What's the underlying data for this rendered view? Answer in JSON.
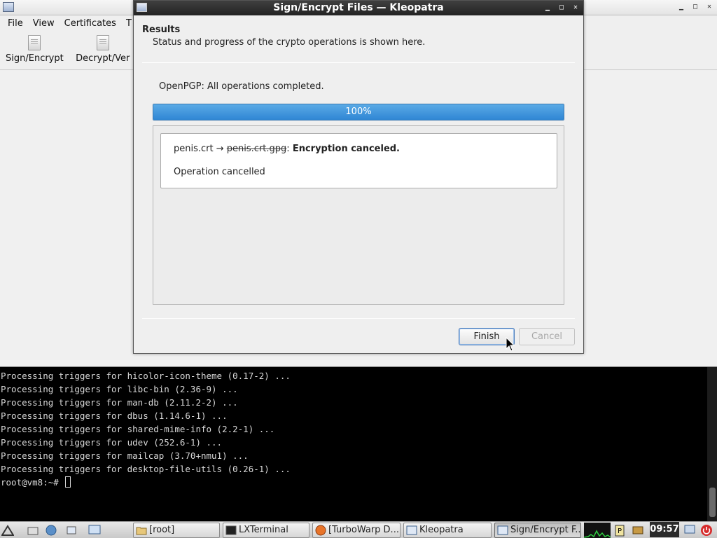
{
  "main_window": {
    "menu": [
      {
        "label": "File"
      },
      {
        "label": "View"
      },
      {
        "label": "Certificates"
      },
      {
        "label": "T"
      }
    ],
    "toolbar": [
      {
        "label": "Sign/Encrypt",
        "icon": "document-icon"
      },
      {
        "label": "Decrypt/Ver",
        "icon": "document-icon"
      }
    ]
  },
  "dialog": {
    "title": "Sign/Encrypt Files — Kleopatra",
    "results_heading": "Results",
    "results_subtitle": "Status and progress of the crypto operations is shown here.",
    "status": "OpenPGP: All operations completed.",
    "progress": {
      "value": 100,
      "label": "100%"
    },
    "result": {
      "source_file": "penis.crt",
      "arrow": "→",
      "output_file": "penis.crt.gpg",
      "message": "Encryption canceled.",
      "detail": "Operation cancelled"
    },
    "finish_label": "Finish",
    "cancel_label": "Cancel"
  },
  "terminal": {
    "lines": [
      "Processing triggers for hicolor-icon-theme (0.17-2) ...",
      "Processing triggers for libc-bin (2.36-9) ...",
      "Processing triggers for man-db (2.11.2-2) ...",
      "Processing triggers for dbus (1.14.6-1) ...",
      "Processing triggers for shared-mime-info (2.2-1) ...",
      "Processing triggers for udev (252.6-1) ...",
      "Processing triggers for mailcap (3.70+nmu1) ...",
      "Processing triggers for desktop-file-utils (0.26-1) ..."
    ],
    "prompt": "root@vm8:~# "
  },
  "taskbar": {
    "tasks": [
      {
        "label": "[root]",
        "icon": "folder-icon"
      },
      {
        "label": "LXTerminal",
        "icon": "terminal-icon"
      },
      {
        "label": "[TurboWarp D...",
        "icon": "firefox-icon"
      },
      {
        "label": "Kleopatra",
        "icon": "window-icon"
      },
      {
        "label": "Sign/Encrypt F...",
        "icon": "window-icon"
      }
    ],
    "clock": "09:57"
  },
  "colors": {
    "progress_fill": "#3b8fd8",
    "dialog_title_bg": "#2f2f2f",
    "terminal_bg": "#000000"
  }
}
